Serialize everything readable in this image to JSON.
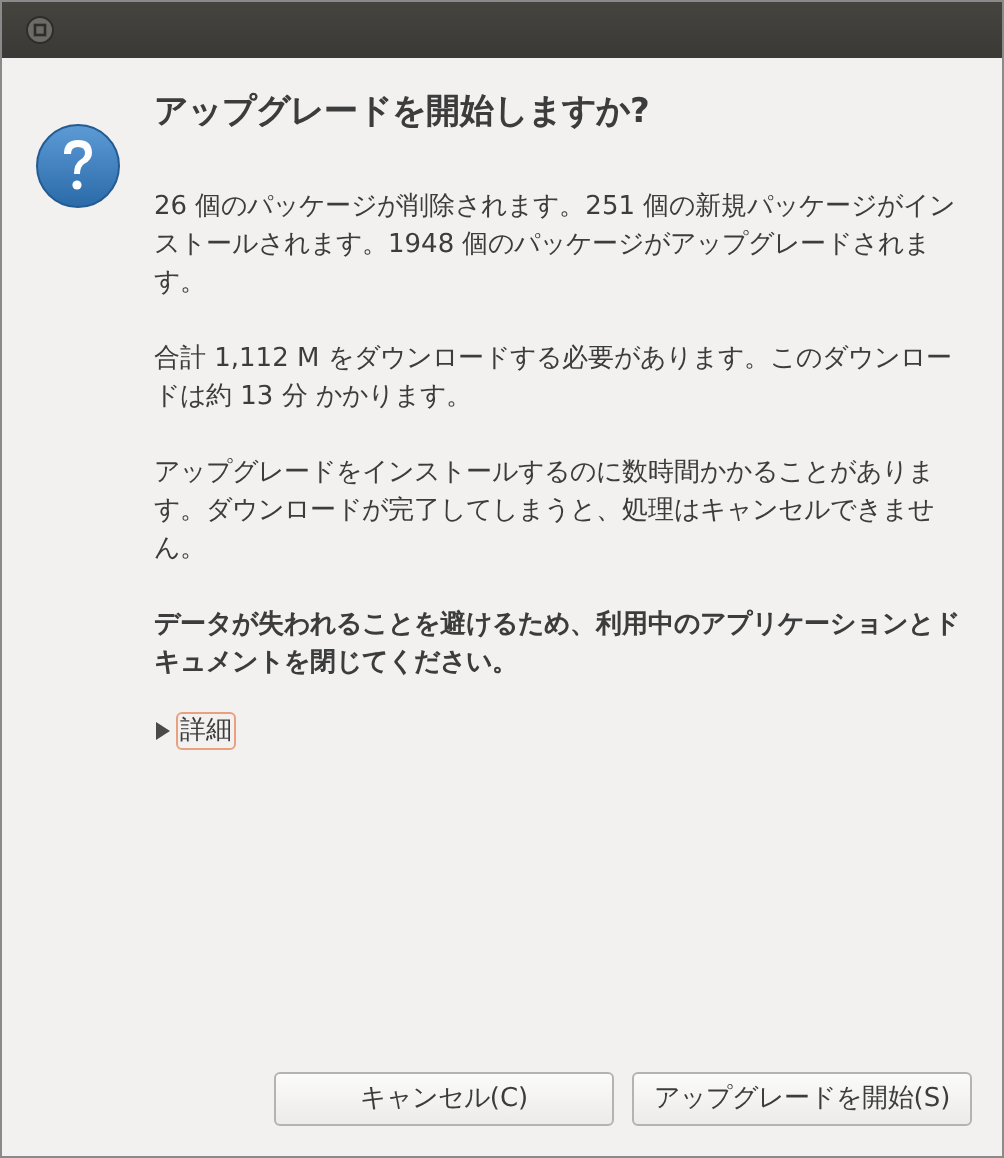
{
  "title": "アップグレードを開始しますか?",
  "paragraphs": [
    {
      "text": "26 個のパッケージが削除されます。251 個の新規パッケージがインストールされます。1948 個のパッケージがアップグレードされます。",
      "bold": false
    },
    {
      "text": "合計 1,112 M をダウンロードする必要があります。このダウンロードは約 13 分 かかります。",
      "bold": false
    },
    {
      "text": "アップグレードをインストールするのに数時間かかることがあります。ダウンロードが完了してしまうと、処理はキャンセルできません。",
      "bold": false
    },
    {
      "text": "データが失われることを避けるため、利用中のアプリケーションとドキュメントを閉じてください。",
      "bold": true
    }
  ],
  "expander": {
    "label": "詳細",
    "expanded": false
  },
  "buttons": [
    "キャンセル(C)",
    "アップグレードを開始(S)"
  ]
}
